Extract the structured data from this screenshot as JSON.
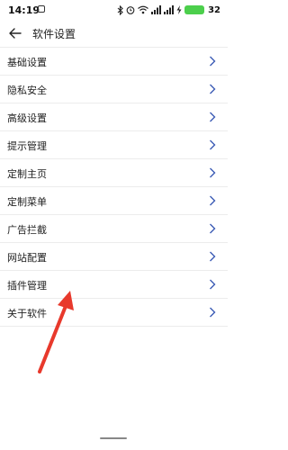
{
  "status_bar": {
    "time": "14:19",
    "battery_level": "32"
  },
  "header": {
    "title": "软件设置",
    "back_icon": "arrow-left-icon"
  },
  "menu": {
    "items": [
      {
        "label": "基础设置",
        "icon": "chevron-right-icon"
      },
      {
        "label": "隐私安全",
        "icon": "chevron-right-icon"
      },
      {
        "label": "高级设置",
        "icon": "chevron-right-icon"
      },
      {
        "label": "提示管理",
        "icon": "chevron-right-icon"
      },
      {
        "label": "定制主页",
        "icon": "chevron-right-icon"
      },
      {
        "label": "定制菜单",
        "icon": "chevron-right-icon"
      },
      {
        "label": "广告拦截",
        "icon": "chevron-right-icon"
      },
      {
        "label": "网站配置",
        "icon": "chevron-right-icon"
      },
      {
        "label": "插件管理",
        "icon": "chevron-right-icon"
      },
      {
        "label": "关于软件",
        "icon": "chevron-right-icon"
      }
    ]
  },
  "colors": {
    "chevron": "#3b5bb5",
    "annotation_arrow": "#e8392c",
    "battery": "#4ccf4c",
    "divider": "#ececec"
  }
}
